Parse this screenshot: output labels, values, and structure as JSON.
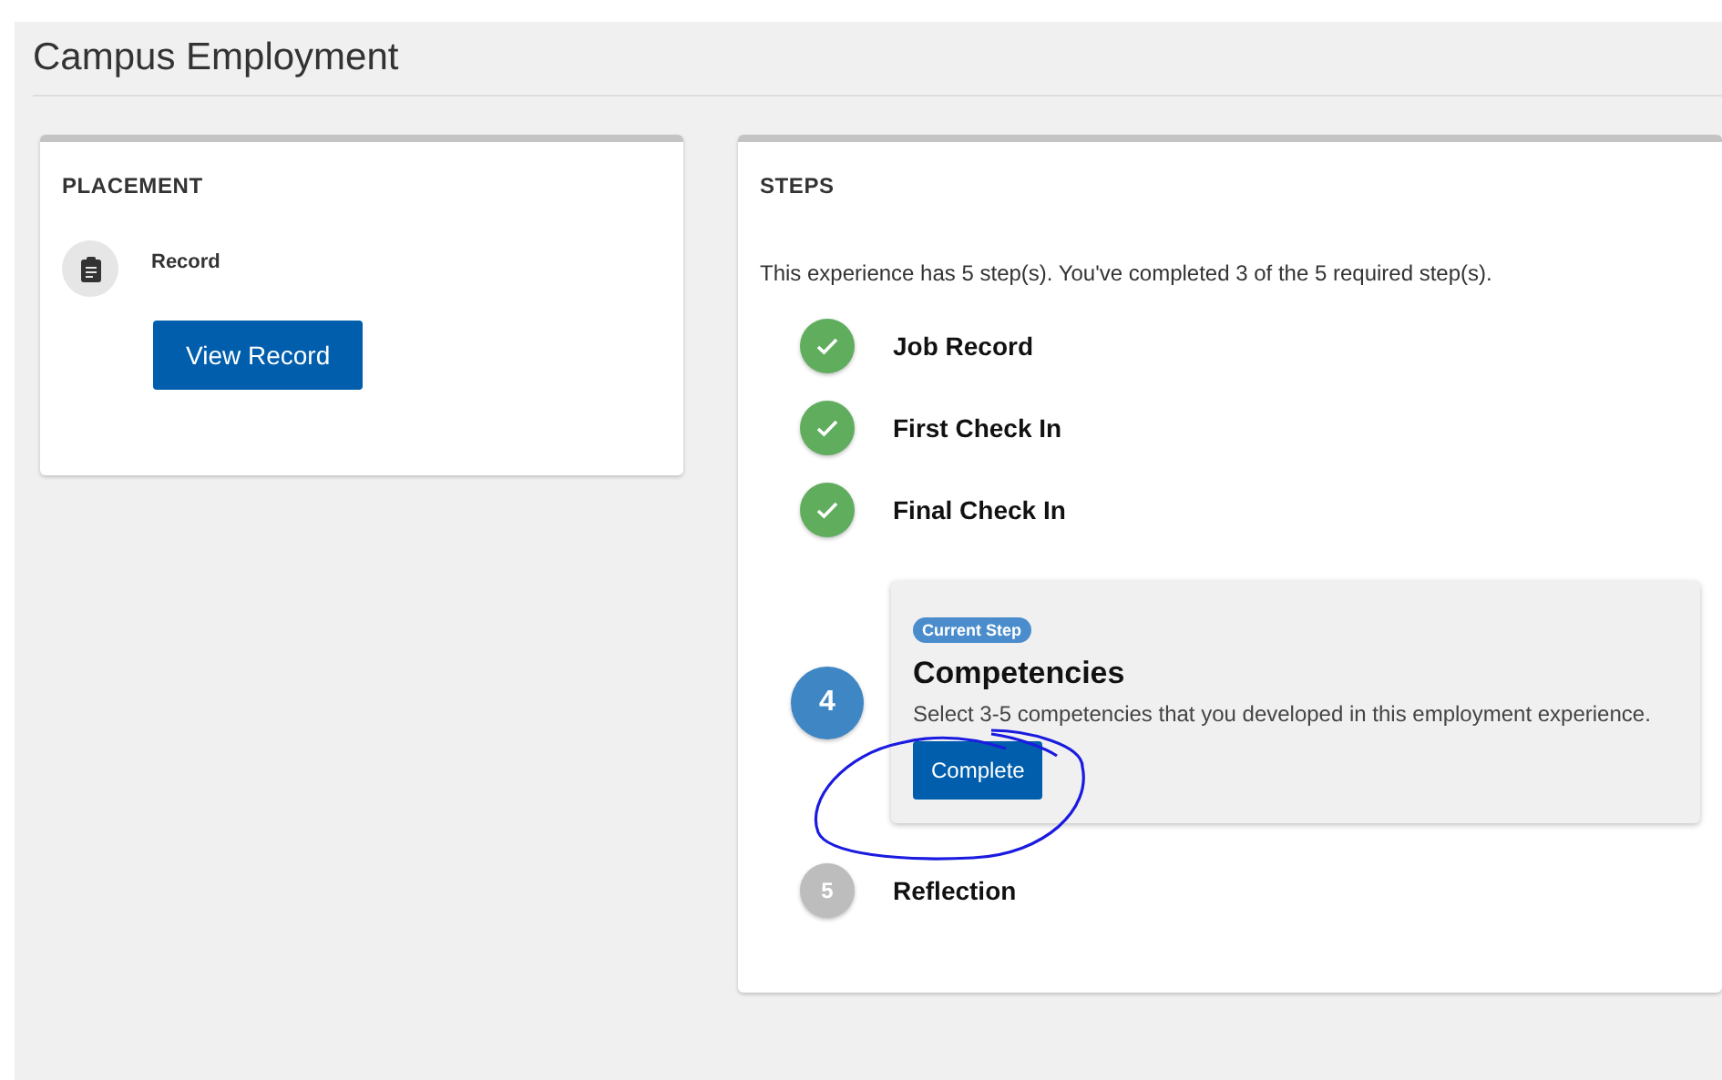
{
  "page_title": "Campus Employment",
  "placement": {
    "heading": "PLACEMENT",
    "item_label": "Record",
    "button": "View Record"
  },
  "steps": {
    "heading": "STEPS",
    "summary": "This experience has 5 step(s). You've completed 3 of the 5 required step(s).",
    "items": [
      {
        "kind": "done",
        "title": "Job Record"
      },
      {
        "kind": "done",
        "title": "First Check In"
      },
      {
        "kind": "done",
        "title": "Final Check In"
      },
      {
        "kind": "current",
        "number": "4",
        "badge": "Current Step",
        "title": "Competencies",
        "description": "Select 3-5 competencies that you developed in this employment experience.",
        "button": "Complete"
      },
      {
        "kind": "pending",
        "number": "5",
        "title": "Reflection"
      }
    ]
  }
}
